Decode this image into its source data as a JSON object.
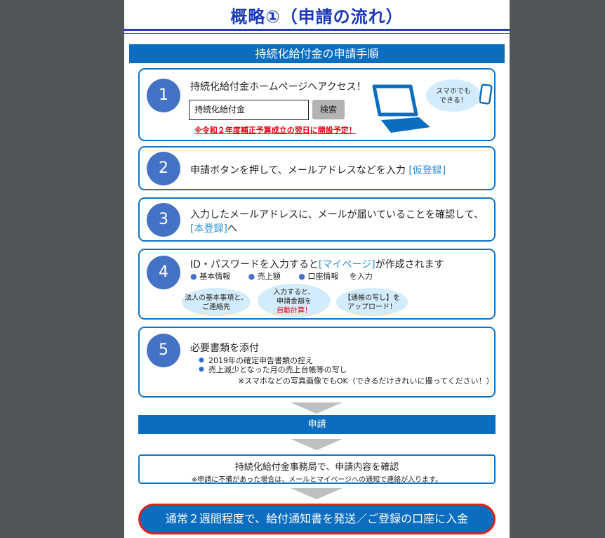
{
  "title": "概略①（申請の流れ）",
  "banner": "持続化給付金の申請手順",
  "step1": {
    "number": "1",
    "text": "持続化給付金ホームページへアクセス！",
    "search_value": "持続化給付金",
    "search_button": "検索",
    "note": "※令和２年度補正予算成立の翌日に開設予定！",
    "phone_bubble_line1": "スマホでも",
    "phone_bubble_line2": "できる！"
  },
  "step2": {
    "number": "2",
    "text": "申請ボタンを押して、メールアドレスなどを入力 ",
    "link": "[仮登録]"
  },
  "step3": {
    "number": "3",
    "line1": "入力したメールアドレスに、メールが届いていることを確認して、",
    "link": "[本登録]",
    "suffix": "へ"
  },
  "step4": {
    "number": "4",
    "prefix": "ID・パスワードを入力すると",
    "link": "[マイページ]",
    "suffix": "が作成されます",
    "item1": "基本情報",
    "item2": "売上額",
    "item3": "口座情報",
    "item_suffix": "を入力",
    "cloud1_line1": "法人の基本事項と、",
    "cloud1_line2": "ご連絡先",
    "cloud2_line1": "入力すると、",
    "cloud2_line2": "申請金額を",
    "cloud2_line3": "自動計算！",
    "cloud3_line1": "【通帳の写し】を",
    "cloud3_line2": "アップロード！"
  },
  "step5": {
    "number": "5",
    "text": "必要書類を添付",
    "bullet1": "2019年の確定申告書類の控え",
    "bullet2": "売上減少となった月の売上台帳等の写し",
    "note": "※スマホなどの写真画像でもOK（できるだけきれいに撮ってください！）"
  },
  "apply": "申請",
  "confirm": {
    "main": "持続化給付金事務局で、申請内容を確認",
    "sub": "※申請に不備があった場合は、メールとマイページへの通知で連絡が入ります。"
  },
  "final": "通常２週間程度で、給付通知書を発送／ご登録の口座に入金",
  "icons": {
    "laptop": "laptop-icon",
    "phone": "smartphone-icon"
  },
  "colors": {
    "primary_blue": "#0b6dbf",
    "title_blue": "#1c39b8",
    "accent_red": "#e60012",
    "circle_blue": "#4472c4"
  }
}
